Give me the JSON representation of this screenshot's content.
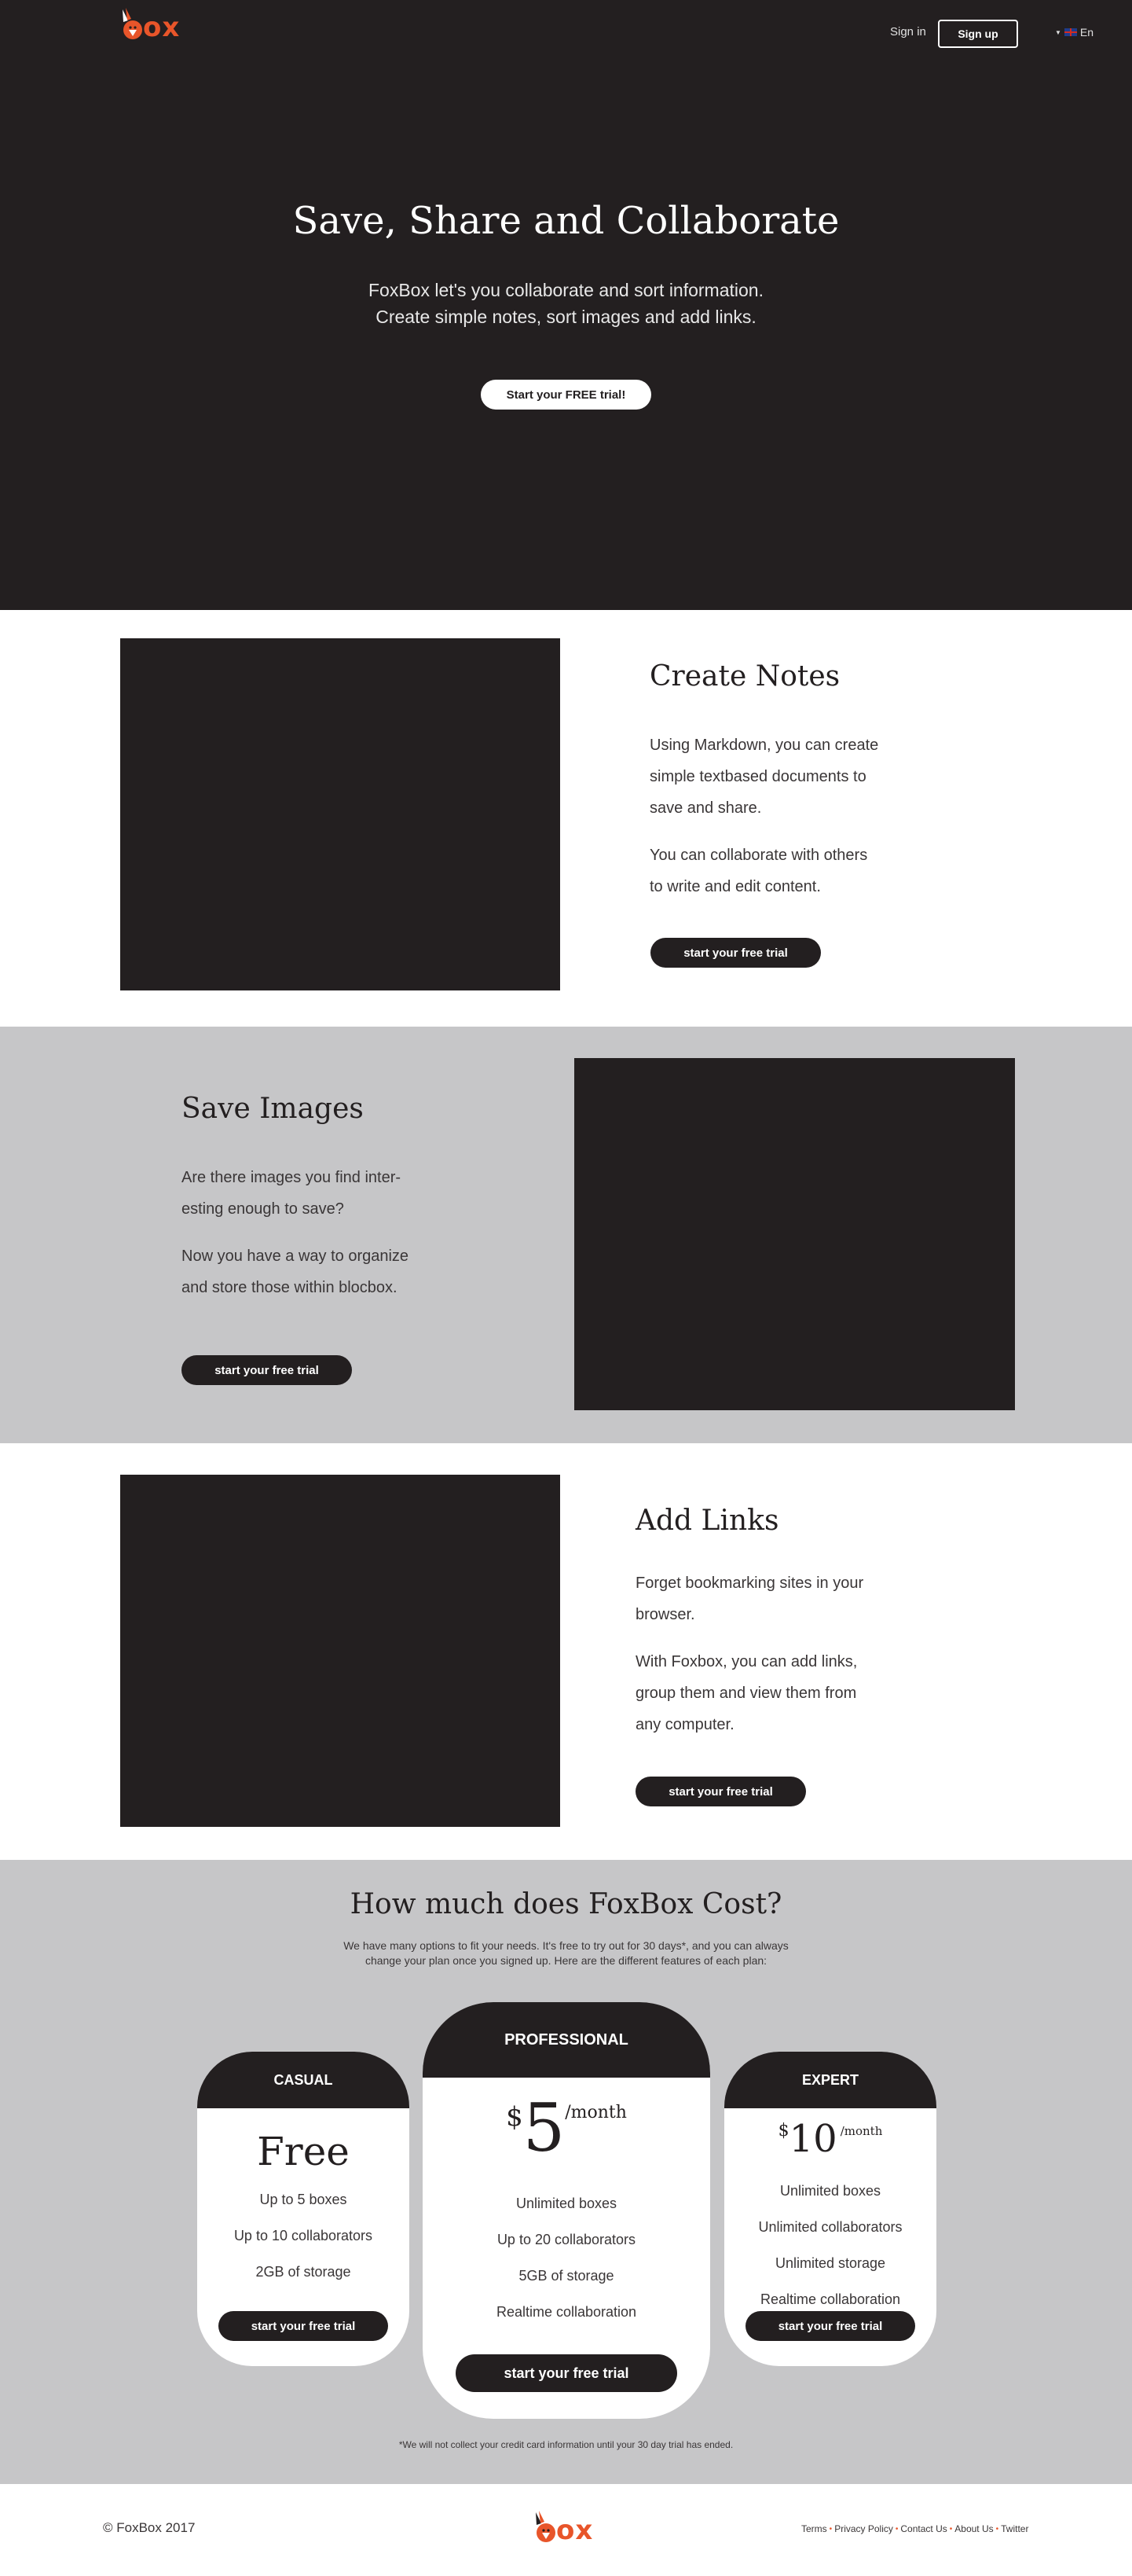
{
  "brand": {
    "logo_text": "ox",
    "accent_color": "#e8552a",
    "dark_color": "#231f20",
    "gray_color": "#c6c6c8"
  },
  "nav": {
    "sign_in": "Sign in",
    "sign_up": "Sign up",
    "language": "En"
  },
  "hero": {
    "title": "Save, Share and Collaborate",
    "subtitle_line1": "FoxBox let's you collaborate and sort information.",
    "subtitle_line2": "Create simple notes, sort images and add links.",
    "cta": "Start your FREE trial!"
  },
  "features": [
    {
      "title": "Create Notes",
      "paragraphs": [
        [
          "Using Markdown, you can create",
          "simple textbased documents to",
          "save and share."
        ],
        [
          "You can collaborate with others",
          "to write and edit content."
        ]
      ],
      "cta": "start your free trial"
    },
    {
      "title": "Save Images",
      "paragraphs": [
        [
          "Are there images you find inter-",
          "esting enough to save?"
        ],
        [
          "Now you have a way to organize",
          "and store those within blocbox."
        ]
      ],
      "cta": "start your free trial"
    },
    {
      "title": "Add Links",
      "paragraphs": [
        [
          "Forget bookmarking sites in your",
          "browser."
        ],
        [
          "With Foxbox, you can add links,",
          "group them and view them from",
          "any computer."
        ]
      ],
      "cta": "start your free trial"
    }
  ],
  "pricing": {
    "title": "How much does FoxBox Cost?",
    "subtitle_line1": "We have many options to fit your needs. It's free to try out for 30 days*, and you can always",
    "subtitle_line2": "change your plan once you signed up. Here are the different features of each plan:",
    "plans": [
      {
        "name": "CASUAL",
        "price": "Free",
        "features": [
          "Up to 5 boxes",
          "Up to 10 collaborators",
          "2GB of storage"
        ],
        "cta": "start your free trial"
      },
      {
        "name": "PROFESSIONAL",
        "currency": "$",
        "amount": "5",
        "period": "/month",
        "features": [
          "Unlimited boxes",
          "Up to 20 collaborators",
          "5GB of storage",
          "Realtime collaboration"
        ],
        "cta": "start your free trial"
      },
      {
        "name": "EXPERT",
        "currency": "$",
        "amount": "10",
        "period": "/month",
        "features": [
          "Unlimited boxes",
          "Unlimited collaborators",
          "Unlimited storage",
          "Realtime collaboration"
        ],
        "cta": "start your free trial"
      }
    ],
    "note": "*We will not collect your credit card information until your 30 day trial has ended."
  },
  "footer": {
    "copyright": "© FoxBox 2017",
    "links": [
      "Terms",
      "Privacy Policy",
      "Contact Us",
      "About Us",
      "Twitter"
    ]
  }
}
